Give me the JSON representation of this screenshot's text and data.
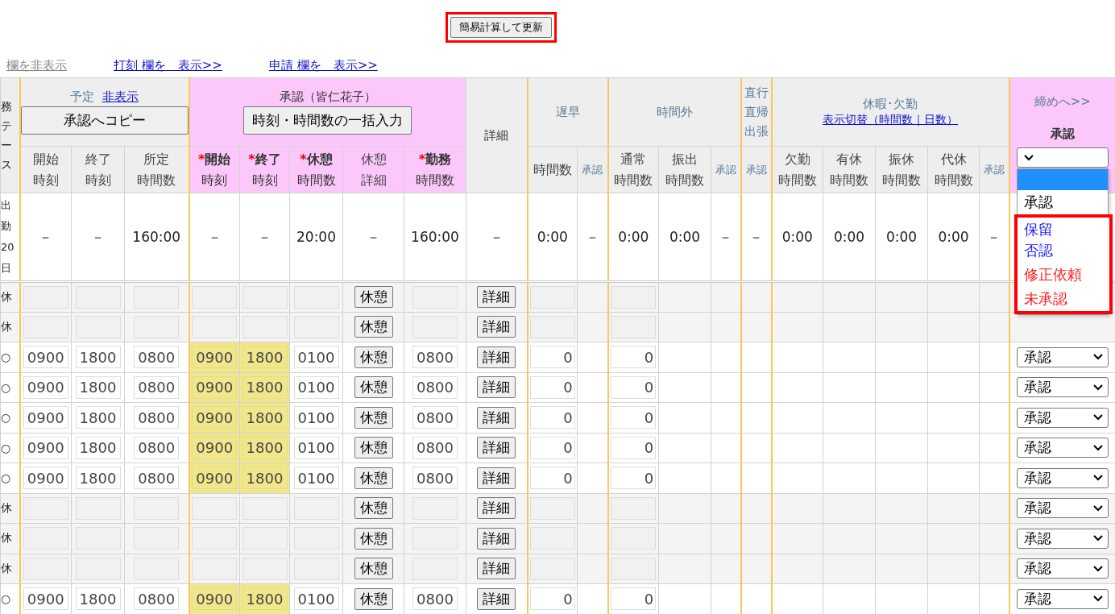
{
  "update_button": {
    "label": "簡易計算して更新",
    "highlighted": true
  },
  "column_toggles": [
    {
      "label": "欄を非表示",
      "kind": "hide"
    },
    {
      "label": "打刻 欄を　表示>>",
      "kind": "show"
    },
    {
      "label": "申請 欄を　表示>>",
      "kind": "show"
    }
  ],
  "header": {
    "status_column": [
      "務",
      "テ",
      "ー",
      "ス"
    ],
    "plan": {
      "title": "予定",
      "hide_link": "非表示",
      "copy_button": "承認へコピー",
      "columns": [
        {
          "lines": [
            "開始",
            "時刻"
          ],
          "kind": "plain"
        },
        {
          "lines": [
            "終了",
            "時刻"
          ],
          "kind": "plain"
        },
        {
          "lines": [
            "所定",
            "時間数"
          ],
          "kind": "plain"
        }
      ]
    },
    "approval": {
      "title": "承認（皆仁花子）",
      "bulk_button": "時刻・時間数の一括入力",
      "columns": [
        {
          "lines": [
            "開始",
            "時刻"
          ],
          "kind": "required",
          "mark": "*"
        },
        {
          "lines": [
            "終了",
            "時刻"
          ],
          "kind": "required",
          "mark": "*"
        },
        {
          "lines": [
            "休憩",
            "時間数"
          ],
          "kind": "required",
          "mark": "*"
        },
        {
          "lines": [
            "休憩",
            "詳細"
          ],
          "kind": "plain"
        },
        {
          "lines": [
            "勤務",
            "時間数"
          ],
          "kind": "required",
          "mark": "*"
        }
      ]
    },
    "detail": "詳細",
    "late": {
      "title": "遅早",
      "columns": [
        {
          "lines": [
            "時間数"
          ],
          "kind": "plain"
        },
        {
          "lines": [
            "承認"
          ],
          "kind": "approval"
        }
      ]
    },
    "overtime": {
      "title": "時間外",
      "columns": [
        {
          "lines": [
            "通常",
            "時間数"
          ],
          "kind": "plain"
        },
        {
          "lines": [
            "振出",
            "時間数"
          ],
          "kind": "plain"
        },
        {
          "lines": [
            "承認"
          ],
          "kind": "approval"
        }
      ]
    },
    "direct": {
      "title": [
        "直行",
        "直帰",
        "出張"
      ],
      "columns": [
        {
          "lines": [
            "承認"
          ],
          "kind": "approval"
        }
      ]
    },
    "leave": {
      "title": "休暇･欠勤",
      "toggle_link": "表示切替（時間数｜日数）",
      "columns": [
        {
          "lines": [
            "欠勤",
            "時間数"
          ],
          "kind": "plain"
        },
        {
          "lines": [
            "有休",
            "時間数"
          ],
          "kind": "plain"
        },
        {
          "lines": [
            "振休",
            "時間数"
          ],
          "kind": "plain"
        },
        {
          "lines": [
            "代休",
            "時間数"
          ],
          "kind": "plain"
        },
        {
          "lines": [
            "承認"
          ],
          "kind": "approval"
        }
      ]
    },
    "closing": {
      "link": "締めへ>>",
      "label": "承認",
      "select": {
        "expanded": true,
        "options": [
          {
            "selected": true
          },
          {
            "label": "承認",
            "selected": false,
            "color": "#000000",
            "highlighted": false
          },
          {
            "label": "保留",
            "selected": false,
            "color": "#1a1aff",
            "highlighted": true
          },
          {
            "label": "否認",
            "selected": false,
            "color": "#1a1aff",
            "highlighted": true
          },
          {
            "label": "修正依頼",
            "selected": false,
            "color": "#ff1a1a",
            "highlighted": true
          },
          {
            "label": "未承認",
            "selected": false,
            "color": "#ff1a1a",
            "highlighted": true
          }
        ]
      }
    }
  },
  "summary": {
    "status": [
      "出",
      "勤",
      "20",
      "日"
    ],
    "values": [
      "－",
      "－",
      "160:00",
      "－",
      "－",
      "20:00",
      "－",
      "160:00",
      "－",
      "0:00",
      "－",
      "0:00",
      "0:00",
      "－",
      "－",
      "0:00",
      "0:00",
      "0:00",
      "0:00",
      "－"
    ]
  },
  "rows": [
    {
      "kind": "off",
      "status": "休",
      "break_button": "休憩",
      "detail_button": "詳細"
    },
    {
      "kind": "off",
      "status": "休",
      "break_button": "休憩",
      "detail_button": "詳細"
    },
    {
      "kind": "work",
      "status": "○",
      "plan_start": "0900",
      "plan_end": "1800",
      "plan_hours": "0800",
      "start": "0900",
      "end": "1800",
      "break": "0100",
      "break_button": "休憩",
      "work": "0800",
      "detail_button": "詳細",
      "late": "0",
      "overtime": "0",
      "approval": "承認"
    },
    {
      "kind": "work",
      "status": "○",
      "plan_start": "0900",
      "plan_end": "1800",
      "plan_hours": "0800",
      "start": "0900",
      "end": "1800",
      "break": "0100",
      "break_button": "休憩",
      "work": "0800",
      "detail_button": "詳細",
      "late": "0",
      "overtime": "0",
      "approval": "承認"
    },
    {
      "kind": "work",
      "status": "○",
      "plan_start": "0900",
      "plan_end": "1800",
      "plan_hours": "0800",
      "start": "0900",
      "end": "1800",
      "break": "0100",
      "break_button": "休憩",
      "work": "0800",
      "detail_button": "詳細",
      "late": "0",
      "overtime": "0",
      "approval": "承認"
    },
    {
      "kind": "work",
      "status": "○",
      "plan_start": "0900",
      "plan_end": "1800",
      "plan_hours": "0800",
      "start": "0900",
      "end": "1800",
      "break": "0100",
      "break_button": "休憩",
      "work": "0800",
      "detail_button": "詳細",
      "late": "0",
      "overtime": "0",
      "approval": "承認"
    },
    {
      "kind": "work",
      "status": "○",
      "plan_start": "0900",
      "plan_end": "1800",
      "plan_hours": "0800",
      "start": "0900",
      "end": "1800",
      "break": "0100",
      "break_button": "休憩",
      "work": "0800",
      "detail_button": "詳細",
      "late": "0",
      "overtime": "0",
      "approval": "承認"
    },
    {
      "kind": "off",
      "status": "休",
      "break_button": "休憩",
      "detail_button": "詳細",
      "approval": "承認"
    },
    {
      "kind": "off",
      "status": "休",
      "break_button": "休憩",
      "detail_button": "詳細",
      "approval": "承認"
    },
    {
      "kind": "off",
      "status": "休",
      "break_button": "休憩",
      "detail_button": "詳細",
      "approval": "承認"
    },
    {
      "kind": "work",
      "status": "○",
      "plan_start": "0900",
      "plan_end": "1800",
      "plan_hours": "0800",
      "start": "0900",
      "end": "1800",
      "break": "0100",
      "break_button": "休憩",
      "work": "0800",
      "detail_button": "詳細",
      "late": "0",
      "overtime": "0",
      "approval": "承認"
    }
  ]
}
